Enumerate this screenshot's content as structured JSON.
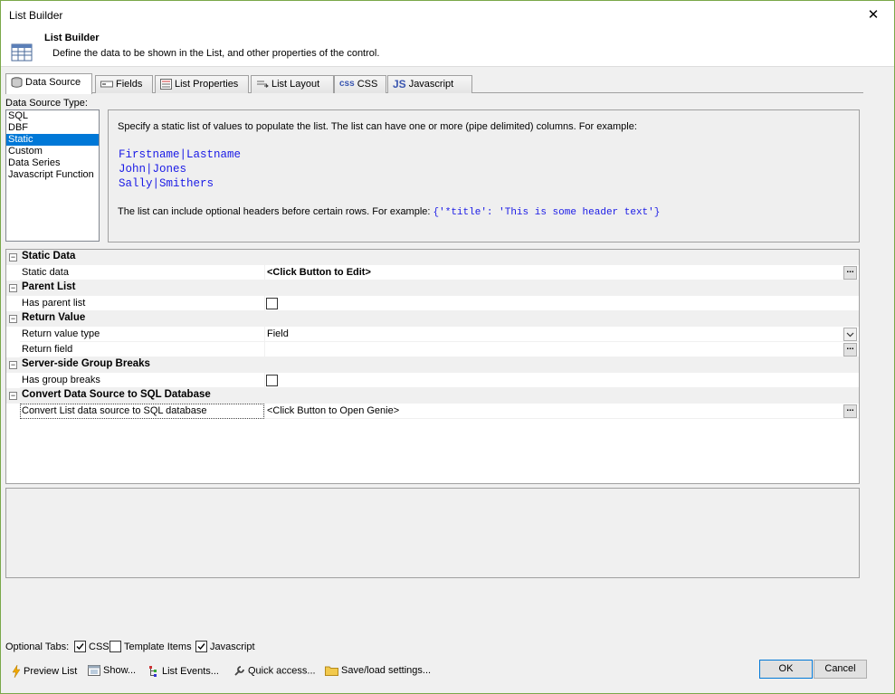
{
  "window": {
    "title": "List Builder",
    "close_glyph": "✕"
  },
  "header": {
    "title": "List Builder",
    "description": "Define the data to be shown in the List, and other properties of the control."
  },
  "tabs": [
    {
      "label": "Data Source",
      "icon": "database-icon"
    },
    {
      "label": "Fields",
      "icon": "fields-icon"
    },
    {
      "label": "List Properties",
      "icon": "properties-icon"
    },
    {
      "label": "List Layout",
      "icon": "layout-icon"
    },
    {
      "label": "CSS",
      "icon": "css-icon",
      "badge": "css"
    },
    {
      "label": "Javascript",
      "icon": "js-icon",
      "badge": "JS"
    }
  ],
  "data_source": {
    "label": "Data Source Type:",
    "items": [
      "SQL",
      "DBF",
      "Static",
      "Custom",
      "Data Series",
      "Javascript Function"
    ],
    "selected": "Static"
  },
  "info": {
    "intro": "Specify a static list of values to populate the list. The list can have one or more (pipe delimited) columns. For example:",
    "code_lines": [
      "Firstname|Lastname",
      "John|Jones",
      "Sally|Smithers"
    ],
    "headers_note": "The list can include optional headers before certain rows. For example: ",
    "headers_example": "{'*title': 'This is some header text'}"
  },
  "grid": {
    "static_data": {
      "category": "Static Data",
      "label": "Static data",
      "value": "<Click Button to Edit>"
    },
    "parent_list": {
      "category": "Parent List",
      "label": "Has parent list"
    },
    "return_value": {
      "category": "Return Value",
      "type_label": "Return value type",
      "type_value": "Field",
      "field_label": "Return field",
      "field_value": ""
    },
    "group_breaks": {
      "category": "Server-side Group Breaks",
      "label": "Has group breaks"
    },
    "convert": {
      "category": "Convert Data Source to SQL Database",
      "label": "Convert List data source to SQL database",
      "value": "<Click Button to Open Genie>"
    },
    "toggle_glyph": "−",
    "ellipsis": "..."
  },
  "optional_tabs": {
    "label": "Optional Tabs:",
    "css": {
      "label": "CSS",
      "checked": true
    },
    "template": {
      "label": "Template Items",
      "checked": false
    },
    "javascript": {
      "label": "Javascript",
      "checked": true
    }
  },
  "toolbar": {
    "preview": "Preview List",
    "show": "Show...",
    "events": "List Events...",
    "quick": "Quick access...",
    "save": "Save/load settings..."
  },
  "buttons": {
    "ok": "OK",
    "cancel": "Cancel"
  }
}
